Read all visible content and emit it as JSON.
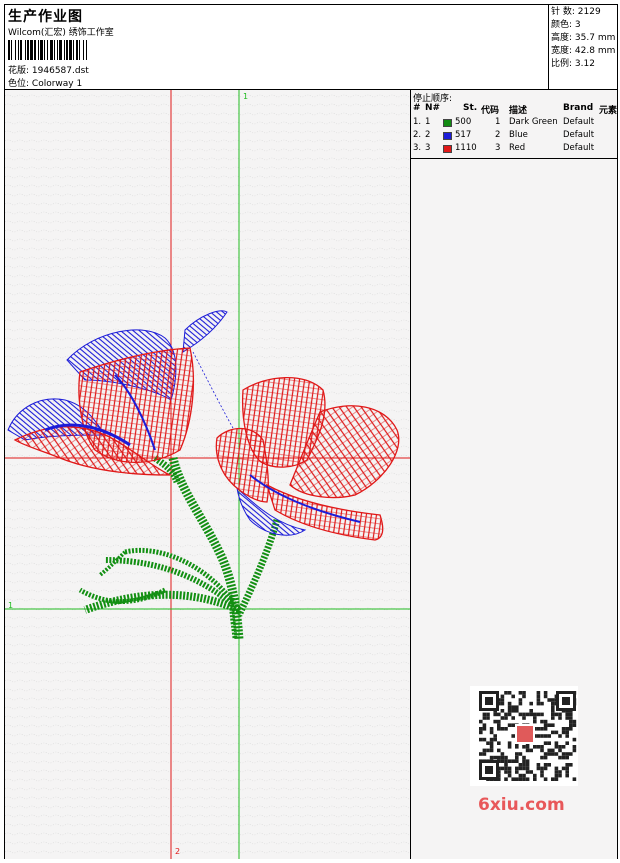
{
  "header": {
    "title": "生产作业图",
    "company": "Wilcom(汇宏) 绣饰工作室",
    "file_label": "花版:",
    "file_value": "1946587.dst",
    "colorway_label": "色位:",
    "colorway_value": "Colorway 1"
  },
  "stats": [
    {
      "label": "针 数:",
      "value": "2129"
    },
    {
      "label": "颜色:",
      "value": "3"
    },
    {
      "label": "高度:",
      "value": "35.7 mm"
    },
    {
      "label": "宽度:",
      "value": "42.8 mm"
    },
    {
      "label": "比例:",
      "value": "3.12"
    }
  ],
  "stop_sequence": {
    "title": "停止顺序:",
    "columns": [
      "#",
      "N#",
      "St.",
      "代码",
      "描述",
      "Brand",
      "元素"
    ],
    "rows": [
      {
        "index": "1.",
        "n": "1",
        "stitches": "500",
        "code": "1",
        "description": "Dark Green",
        "brand": "Default",
        "color": "#118a11"
      },
      {
        "index": "2.",
        "n": "2",
        "stitches": "517",
        "code": "2",
        "description": "Blue",
        "brand": "Default",
        "color": "#1c1cd8"
      },
      {
        "index": "3.",
        "n": "3",
        "stitches": "1110",
        "code": "3",
        "description": "Red",
        "brand": "Default",
        "color": "#e01818"
      }
    ]
  },
  "axes": {
    "green_vertical_label": "1",
    "green_horizontal_label": "1",
    "red_vertical_label": "2"
  },
  "watermark": {
    "text": "6xiu.com"
  },
  "colors": {
    "green": "#22bb22",
    "red": "#e01818",
    "blue": "#1c1cd8",
    "dark_green": "#128f12"
  }
}
